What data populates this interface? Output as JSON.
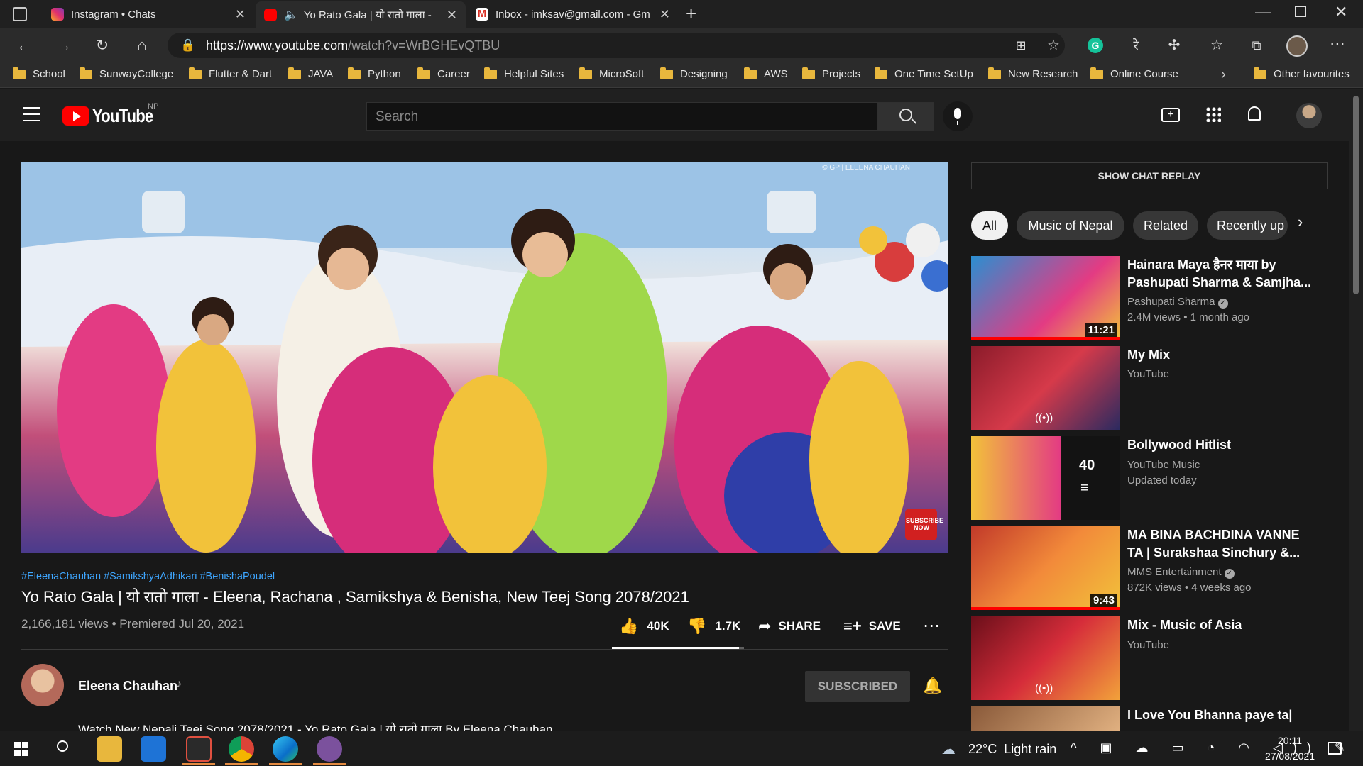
{
  "tabs": [
    {
      "title": "Instagram • Chats"
    },
    {
      "title": "Yo Rato Gala | यो रातो गाला -"
    },
    {
      "title": "Inbox - imksav@gmail.com - Gm"
    }
  ],
  "address": {
    "host": "https://www.youtube.com",
    "path": "/watch?v=WrBGHEvQTBU"
  },
  "bookmarks": [
    "School",
    "SunwayCollege",
    "Flutter & Dart",
    "JAVA",
    "Python",
    "Career",
    "Helpful Sites",
    "MicroSoft",
    "Designing",
    "AWS",
    "Projects",
    "One Time SetUp",
    "New Research",
    "Online Course",
    "Other favourites"
  ],
  "youtube": {
    "logo": "YouTube",
    "region": "NP",
    "search_placeholder": "Search"
  },
  "video": {
    "watermark": "© GP | ELEENA CHAUHAN",
    "hashtags": "#EleenaChauhan #SamikshyaAdhikari #BenishaPoudel",
    "title": "Yo Rato Gala | यो रातो गाला - Eleena, Rachana , Samikshya & Benisha, New Teej Song 2078/2021",
    "views_date": "2,166,181 views • Premiered Jul 20, 2021",
    "likes": "40K",
    "dislikes": "1.7K",
    "share": "SHARE",
    "save": "SAVE",
    "like_ratio": 0.96,
    "subscribe_badge": "SUBSCRIBE NOW"
  },
  "channel": {
    "name": "Eleena Chauhan",
    "subscribe_label": "SUBSCRIBED",
    "description": "Watch New Nepali Teej Song 2078/2021 - Yo Rato Gala | यो रातो गाला By Eleena Chauhan"
  },
  "sidebar": {
    "chat_replay": "SHOW CHAT REPLAY",
    "chips": [
      "All",
      "Music of Nepal",
      "Related",
      "Recently up"
    ],
    "items": [
      {
        "title1": "Hainara Maya हैनर माया by",
        "title2": "Pashupati Sharma & Samjha...",
        "meta1": "Pashupati Sharma",
        "meta2": "2.4M views • 1 month ago",
        "duration": "11:21"
      },
      {
        "title1": "My Mix",
        "title2": "",
        "meta1": "YouTube",
        "meta2": "",
        "duration": ""
      },
      {
        "title1": "Bollywood Hitlist",
        "title2": "",
        "meta1": "YouTube Music",
        "meta2": "Updated today",
        "duration": "",
        "count": "40"
      },
      {
        "title1": "MA BINA BACHDINA VANNE",
        "title2": "TA | Surakshaa Sinchury &...",
        "meta1": "MMS Entertainment",
        "meta2": "872K views • 4 weeks ago",
        "duration": "9:43"
      },
      {
        "title1": "Mix - Music of Asia",
        "title2": "",
        "meta1": "YouTube",
        "meta2": "",
        "duration": ""
      },
      {
        "title1": "I Love You Bhanna paye ta|",
        "title2": "",
        "meta1": "",
        "meta2": "",
        "duration": ""
      }
    ]
  },
  "taskbar": {
    "weather": "22°C  Light rain",
    "time": "20:11",
    "date": "27/08/2021"
  },
  "colors": {
    "accent": "#3ea6ff",
    "youtube_red": "#ff0000",
    "bg": "#181818"
  }
}
